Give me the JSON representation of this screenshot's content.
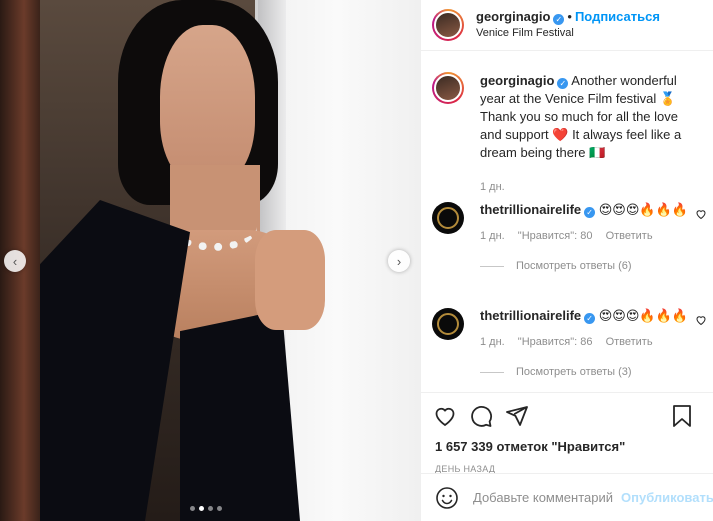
{
  "post": {
    "username": "georginagio",
    "follow_label": "Подписаться",
    "separator": "•",
    "location": "Venice Film Festival"
  },
  "caption": {
    "username": "georginagio",
    "text": " Another wonderful year at the Venice Film festival 🏅 Thank you so much for all the love and support ❤️ It always feel like a dream being there 🇮🇹",
    "time": "1 дн."
  },
  "comments": [
    {
      "username": "thetrillionairelife",
      "text": " 😍😍😍🔥🔥🔥",
      "time": "1 дн.",
      "likes": "\"Нравится\": 80",
      "reply": "Ответить",
      "view_replies": "Посмотреть ответы (6)"
    },
    {
      "username": "thetrillionairelife",
      "text": " 😍😍😍🔥🔥🔥",
      "time": "1 дн.",
      "likes": "\"Нравится\": 86",
      "reply": "Ответить",
      "view_replies": "Посмотреть ответы (3)"
    }
  ],
  "likes_count": "1 657 339 отметок \"Нравится\"",
  "date_label": "ДЕНЬ НАЗАД",
  "comment_input": {
    "placeholder": "Добавьте комментарий..."
  },
  "publish_label": "Опубликовать",
  "carousel": {
    "total": 4,
    "active": 2
  },
  "colors": {
    "accent": "#0095f6",
    "verified": "#3897f0",
    "publish_disabled": "#b2dffc"
  }
}
